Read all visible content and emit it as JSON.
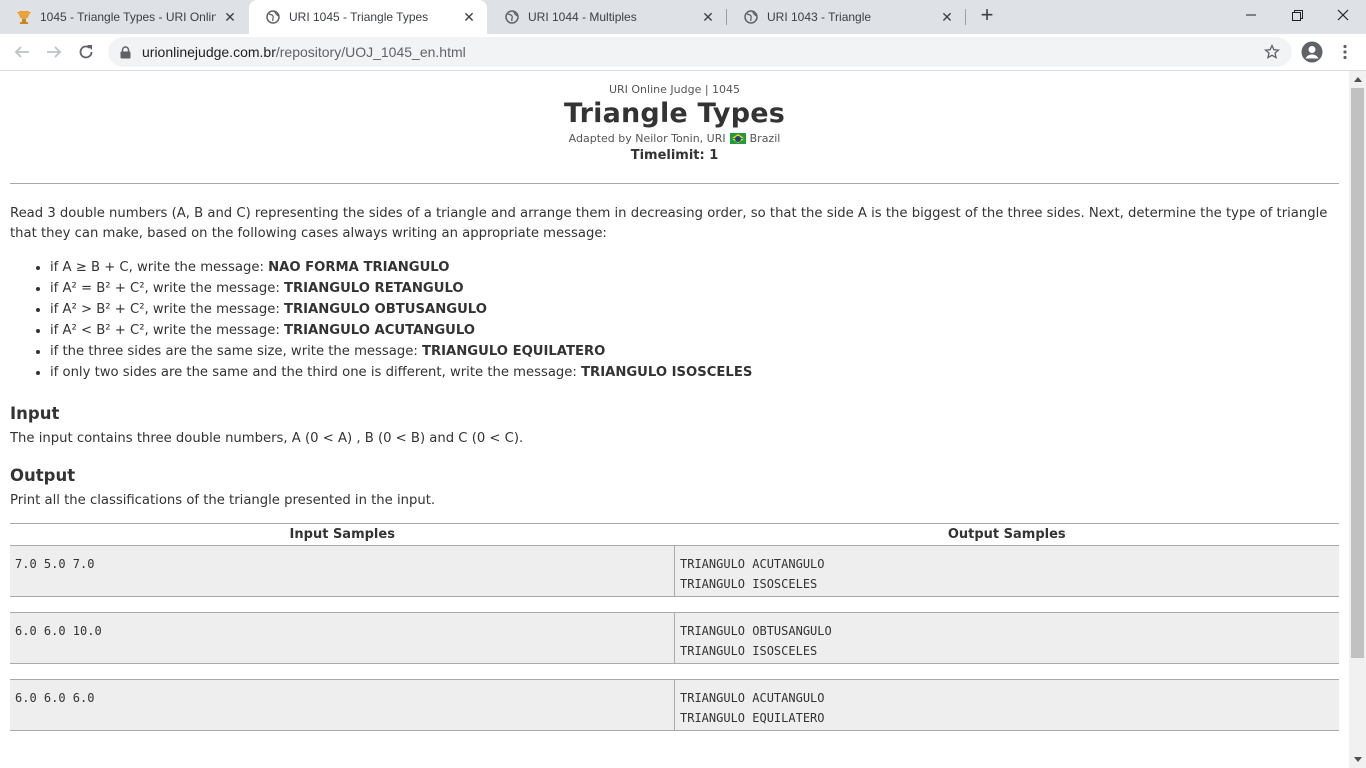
{
  "browser": {
    "tabs": [
      {
        "title": "1045 - Triangle Types - URI Online Judge",
        "icon": "uri-trophy-icon",
        "active": false
      },
      {
        "title": "URI 1045 - Triangle Types",
        "icon": "globe-icon",
        "active": true
      },
      {
        "title": "URI 1044 - Multiples",
        "icon": "globe-icon",
        "active": false
      },
      {
        "title": "URI 1043 - Triangle",
        "icon": "globe-icon",
        "active": false
      }
    ],
    "url_host": "urionlinejudge.com.br",
    "url_path": "/repository/UOJ_1045_en.html"
  },
  "header": {
    "top": "URI Online Judge | 1045",
    "title": "Triangle Types",
    "author_prefix": "Adapted by Neilor Tonin, URI",
    "author_country": "Brazil",
    "timelimit": "Timelimit: 1"
  },
  "description": "Read 3 double numbers (A, B and C) representing the sides of a triangle and arrange them in decreasing order, so that the side A is the biggest of the three sides. Next, determine the type of triangle that they can make, based on the following cases always writing an appropriate message:",
  "cases": [
    {
      "text": "if A ≥ B + C, write the message: ",
      "msg": "NAO FORMA TRIANGULO"
    },
    {
      "text": "if A² = B² + C², write the message: ",
      "msg": "TRIANGULO RETANGULO"
    },
    {
      "text": "if A² > B² + C², write the message: ",
      "msg": "TRIANGULO OBTUSANGULO"
    },
    {
      "text": "if A² < B² + C², write the message: ",
      "msg": "TRIANGULO ACUTANGULO"
    },
    {
      "text": "if the three sides are the same size, write the message: ",
      "msg": "TRIANGULO EQUILATERO"
    },
    {
      "text": "if only two sides are the same and the third one is different, write the message: ",
      "msg": "TRIANGULO ISOSCELES"
    }
  ],
  "input": {
    "heading": "Input",
    "text": "The input contains three double numbers, A (0 < A) , B (0 < B) and C (0 < C)."
  },
  "output": {
    "heading": "Output",
    "text": "Print all the classifications of the triangle presented in the input."
  },
  "samples": {
    "input_header": "Input Samples",
    "output_header": "Output Samples",
    "rows": [
      {
        "input": "7.0 5.0 7.0",
        "output": "TRIANGULO ACUTANGULO\nTRIANGULO ISOSCELES"
      },
      {
        "input": "6.0 6.0 10.0",
        "output": "TRIANGULO OBTUSANGULO\nTRIANGULO ISOSCELES"
      },
      {
        "input": "6.0 6.0 6.0",
        "output": "TRIANGULO ACUTANGULO\nTRIANGULO EQUILATERO"
      }
    ]
  }
}
